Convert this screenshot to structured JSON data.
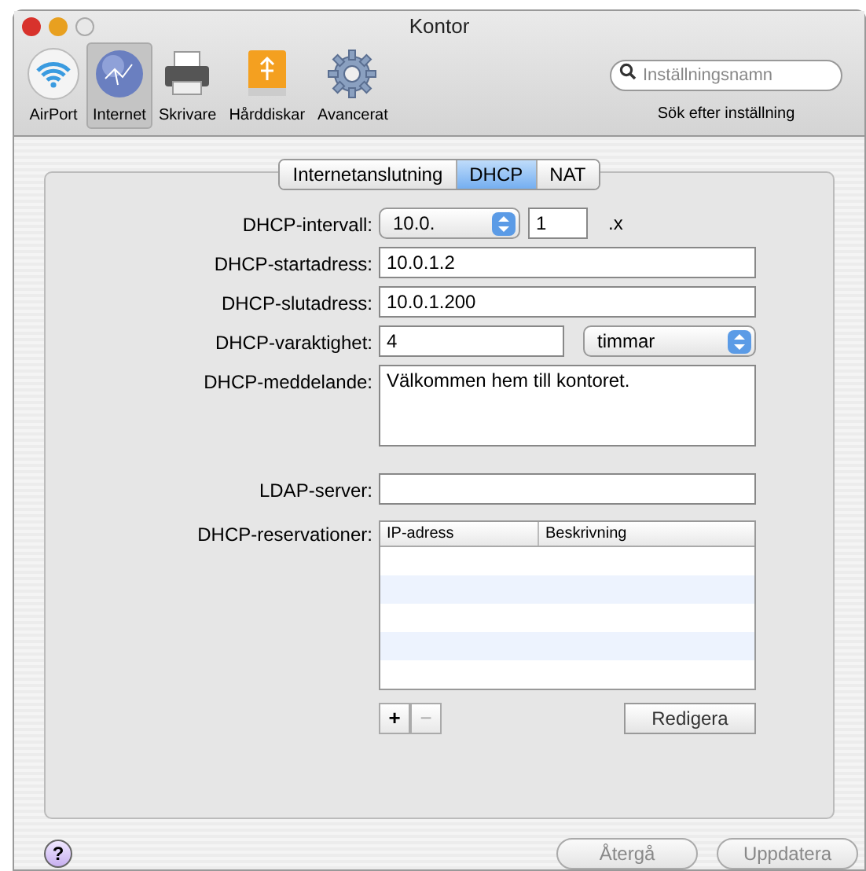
{
  "window": {
    "title": "Kontor"
  },
  "toolbar": [
    {
      "label": "AirPort",
      "kind": "wifi",
      "selected": false
    },
    {
      "label": "Internet",
      "kind": "globe",
      "selected": true
    },
    {
      "label": "Skrivare",
      "kind": "printer",
      "selected": false
    },
    {
      "label": "Hårddiskar",
      "kind": "disk",
      "selected": false
    },
    {
      "label": "Avancerat",
      "kind": "gear",
      "selected": false
    }
  ],
  "search": {
    "placeholder": "Inställningsnamn",
    "caption": "Sök efter inställning"
  },
  "tabs": [
    {
      "label": "Internetanslutning",
      "selected": false
    },
    {
      "label": "DHCP",
      "selected": true
    },
    {
      "label": "NAT",
      "selected": false
    }
  ],
  "fields": [
    {
      "kind": "range",
      "label": "DHCP-intervall:",
      "popup": "10.0.",
      "value": "1",
      "suffix": ".x"
    },
    {
      "kind": "text",
      "label": "DHCP-startadress:",
      "value": "10.0.1.2"
    },
    {
      "kind": "text",
      "label": "DHCP-slutadress:",
      "value": "10.0.1.200"
    },
    {
      "kind": "duration",
      "label": "DHCP-varaktighet:",
      "value": "4",
      "popup": "timmar"
    },
    {
      "kind": "area",
      "label": "DHCP-meddelande:",
      "value": "Välkommen hem till kontoret."
    },
    {
      "kind": "text",
      "label": "LDAP-server:"
    }
  ],
  "reservations": {
    "label": "DHCP-reservationer:",
    "columns": [
      "IP-adress",
      "Beskrivning"
    ],
    "add": {
      "label": "+",
      "disabled": false
    },
    "remove": {
      "label": "−",
      "disabled": true
    },
    "edit": {
      "label": "Redigera",
      "disabled": false
    }
  },
  "footer": {
    "help": "?",
    "buttons": [
      {
        "label": "Återgå",
        "disabled": true
      },
      {
        "label": "Uppdatera",
        "disabled": true
      }
    ]
  }
}
